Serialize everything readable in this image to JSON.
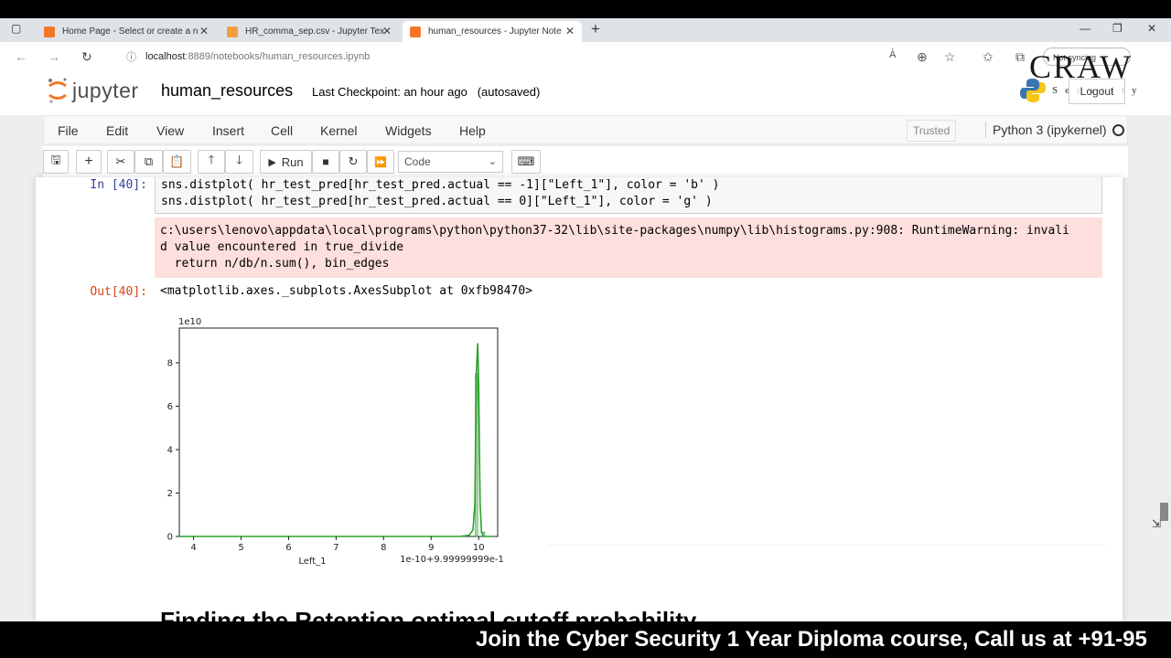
{
  "browser": {
    "tabs": [
      {
        "label": "Home Page - Select or create a n",
        "favicon_color": "#f37626"
      },
      {
        "label": "HR_comma_sep.csv - Jupyter Tex",
        "favicon_color": "#f0a040"
      },
      {
        "label": "human_resources - Jupyter Note",
        "favicon_color": "#f37626"
      }
    ],
    "new_tab": "+",
    "url_host": "localhost",
    "url_path": ":8889/notebooks/human_resources.ipynb",
    "sync_label": "Not syncing"
  },
  "jupyter": {
    "logo_text": "jupyter",
    "notebook_name": "human_resources",
    "checkpoint": "Last Checkpoint: an hour ago",
    "autosave": "(autosaved)",
    "logout": "Logout",
    "menu": [
      "File",
      "Edit",
      "View",
      "Insert",
      "Cell",
      "Kernel",
      "Widgets",
      "Help"
    ],
    "trusted": "Trusted",
    "kernel": "Python 3 (ipykernel)",
    "run_label": "Run",
    "cell_type": "Code"
  },
  "cell": {
    "in_prompt": "In [40]:",
    "code_lines": [
      "sns.distplot( hr_test_pred[hr_test_pred.actual == -1][\"Left_1\"], color = 'b' )",
      "sns.distplot( hr_test_pred[hr_test_pred.actual == 0][\"Left_1\"], color = 'g' )"
    ],
    "stderr_lines": [
      "c:\\users\\lenovo\\appdata\\local\\programs\\python\\python37-32\\lib\\site-packages\\numpy\\lib\\histograms.py:908: RuntimeWarning: invali",
      "d value encountered in true_divide",
      "  return n/db/n.sum(), bin_edges"
    ],
    "out_prompt": "Out[40]:",
    "out_text": "<matplotlib.axes._subplots.AxesSubplot at 0xfb98470>"
  },
  "chart_data": {
    "type": "line",
    "title": "",
    "xlabel": "Left_1",
    "ylabel": "",
    "y_scale_label": "1e10",
    "x_offset_label": "1e-10+9.99999999e-1",
    "xticks": [
      "4",
      "5",
      "6",
      "7",
      "8",
      "9",
      "10"
    ],
    "yticks": [
      "0",
      "2",
      "4",
      "6",
      "8"
    ],
    "xlim": [
      3.7,
      10.4
    ],
    "ylim": [
      0,
      9.6
    ],
    "series": [
      {
        "color": "#2ca02c",
        "x": [
          3.7,
          9.6,
          9.8,
          9.88,
          9.92,
          9.95,
          9.98,
          10.0,
          10.03,
          10.06,
          10.1,
          10.3
        ],
        "y": [
          0,
          0,
          0.05,
          0.3,
          1.5,
          7.5,
          8.9,
          7.0,
          1.5,
          0.2,
          0.0,
          0
        ]
      }
    ],
    "bars": [
      {
        "x0": 9.93,
        "x1": 9.98,
        "value": 7.5,
        "color": "#2ca02c"
      },
      {
        "x0": 10.08,
        "x1": 10.13,
        "value": 0.2,
        "color": "#2ca02c"
      }
    ]
  },
  "heading": "Finding the Retention optimal cutoff probability",
  "banner": "Join the Cyber Security 1 Year Diploma course, Call us at +91-95",
  "watermark": {
    "title": "CRAW",
    "subtitle": "Security"
  }
}
